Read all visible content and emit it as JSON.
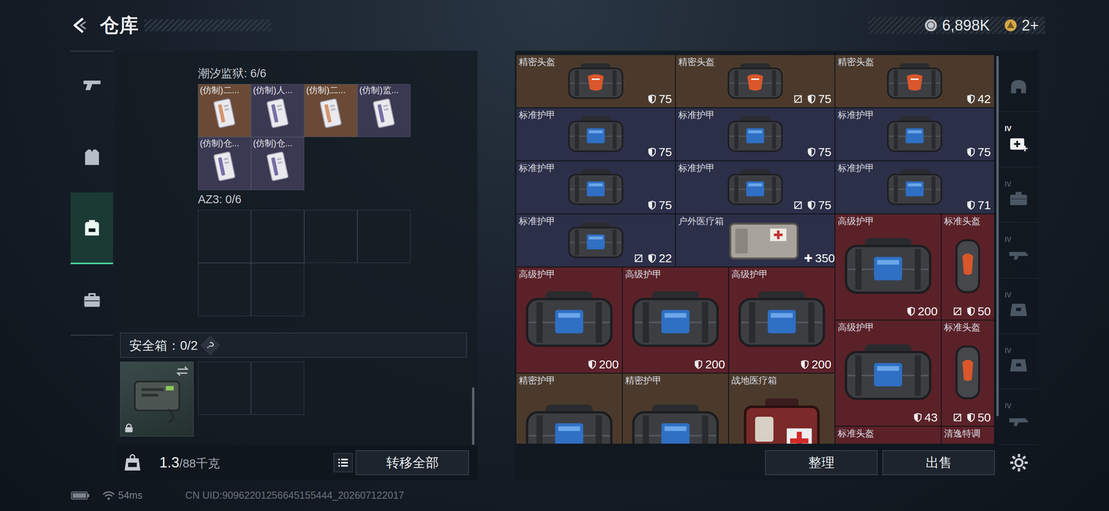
{
  "header": {
    "title": "仓库"
  },
  "currency": [
    {
      "amount": "6,898K",
      "color": "#c3c7cc"
    },
    {
      "amount": "2+",
      "color": "#d4a84a"
    }
  ],
  "sidebar": [
    {
      "kind": "weapon",
      "selected": false
    },
    {
      "kind": "armor",
      "selected": false
    },
    {
      "kind": "backpack",
      "selected": true
    },
    {
      "kind": "toolbox",
      "selected": false
    }
  ],
  "containers": [
    {
      "title": "潮汐监狱: 6/6",
      "slots": 6,
      "items": [
        {
          "name": "(仿制)二...",
          "color": "#6a4a36"
        },
        {
          "name": "(仿制)人...",
          "color": "#3b3852"
        },
        {
          "name": "(仿制)二...",
          "color": "#6a4a36"
        },
        {
          "name": "(仿制)监...",
          "color": "#3b3852"
        },
        {
          "name": "(仿制)仓...",
          "color": "#3b3852"
        },
        {
          "name": "(仿制)仓...",
          "color": "#3b3852"
        }
      ]
    },
    {
      "title": "AZ3: 0/6",
      "slots": 6,
      "items": []
    }
  ],
  "safebox": {
    "title": "安全箱：0/2",
    "help": "?",
    "slots": 2,
    "item": {
      "locked": true
    }
  },
  "weight": {
    "current": "1.3",
    "max": "/88千克"
  },
  "transfer_button": "转移全部",
  "stash": [
    {
      "name": "精密头盔",
      "kind": "precision-helmet",
      "color": "#4b3a2c",
      "value": "75",
      "unrepairable": false
    },
    {
      "name": "精密头盔",
      "kind": "precision-helmet",
      "color": "#4b3a2c",
      "value": "75",
      "unrepairable": true
    },
    {
      "name": "精密头盔",
      "kind": "precision-helmet",
      "color": "#4b3a2c",
      "value": "42",
      "unrepairable": false
    },
    {
      "name": "标准护甲",
      "kind": "standard-armor",
      "color": "#2c2f48",
      "value": "75",
      "unrepairable": false
    },
    {
      "name": "标准护甲",
      "kind": "standard-armor",
      "color": "#2c2f48",
      "value": "75",
      "unrepairable": false
    },
    {
      "name": "标准护甲",
      "kind": "standard-armor",
      "color": "#2c2f48",
      "value": "75",
      "unrepairable": false
    },
    {
      "name": "标准护甲",
      "kind": "standard-armor",
      "color": "#2c2f48",
      "value": "75",
      "unrepairable": false
    },
    {
      "name": "标准护甲",
      "kind": "standard-armor",
      "color": "#2c2f48",
      "value": "75",
      "unrepairable": true
    },
    {
      "name": "标准护甲",
      "kind": "standard-armor",
      "color": "#2c2f48",
      "value": "71",
      "unrepairable": false
    },
    {
      "name": "标准护甲",
      "kind": "standard-armor",
      "color": "#2c2f48",
      "value": "22",
      "unrepairable": true
    },
    {
      "name": "户外医疗箱",
      "kind": "outdoor-medkit",
      "color": "#2c2f48",
      "value": "350",
      "value_icon": "✚",
      "unrepairable": false
    },
    {
      "name": "高级护甲",
      "kind": "advanced-armor",
      "color": "#5b2128",
      "value": "200",
      "unrepairable": false
    },
    {
      "name": "标准头盔",
      "kind": "standard-helmet",
      "color": "#5b2128",
      "value": "50",
      "unrepairable": true
    },
    {
      "name": "高级护甲",
      "kind": "advanced-armor",
      "color": "#5b2128",
      "value": "200",
      "unrepairable": false
    },
    {
      "name": "高级护甲",
      "kind": "advanced-armor",
      "color": "#5b2128",
      "value": "200",
      "unrepairable": false
    },
    {
      "name": "高级护甲",
      "kind": "advanced-armor",
      "color": "#5b2128",
      "value": "200",
      "unrepairable": false
    },
    {
      "name": "高级护甲",
      "kind": "advanced-armor",
      "color": "#5b2128",
      "value": "43",
      "unrepairable": false
    },
    {
      "name": "标准头盔",
      "kind": "standard-helmet",
      "color": "#5b2128",
      "value": "50",
      "unrepairable": true
    },
    {
      "name": "精密护甲",
      "kind": "precision-armor",
      "color": "#4b3a2c"
    },
    {
      "name": "精密护甲",
      "kind": "precision-armor",
      "color": "#4b3a2c"
    },
    {
      "name": "战地医疗箱",
      "kind": "field-medkit",
      "color": "#4b3a2c"
    },
    {
      "name": "标准头盔",
      "kind": "standard-helmet-flat",
      "color": "#5b2128"
    },
    {
      "name": "清逸特调",
      "kind": "drink",
      "color": "#5b2128"
    }
  ],
  "filters": [
    {
      "kind": "helmet",
      "selected": false
    },
    {
      "kind": "medkit",
      "label": "IV",
      "selected": true
    },
    {
      "kind": "case",
      "label": "IV",
      "selected": false
    },
    {
      "kind": "rifle",
      "label": "IV",
      "selected": false
    },
    {
      "kind": "bag",
      "label": "IV",
      "selected": false
    },
    {
      "kind": "bag",
      "label": "IV",
      "selected": false
    },
    {
      "kind": "rifle",
      "label": "IV",
      "selected": false
    }
  ],
  "actions": [
    "整理",
    "出售"
  ],
  "status": {
    "ping": "54ms",
    "uid": "CN UID:90962201256645155444_202607122017"
  }
}
